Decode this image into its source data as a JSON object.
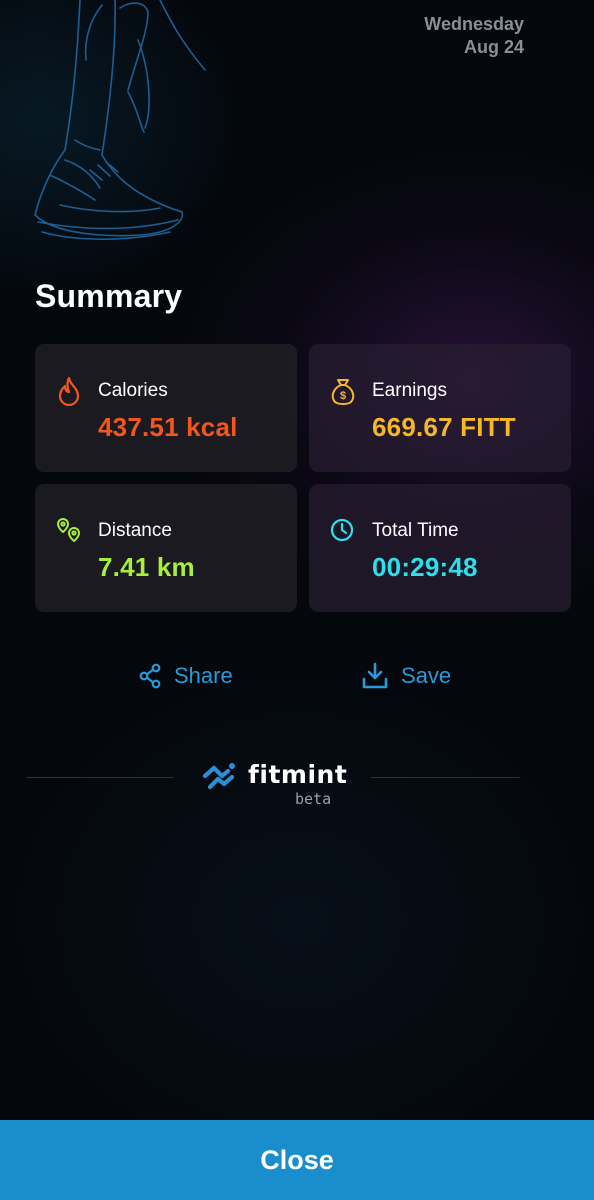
{
  "header": {
    "weekday": "Wednesday",
    "date": "Aug 24"
  },
  "summary": {
    "title": "Summary",
    "stats": [
      {
        "label": "Calories",
        "value": "437.51 kcal",
        "color": "#f4571d",
        "icon": "flame-icon"
      },
      {
        "label": "Earnings",
        "value": "669.67 FITT",
        "color": "#f6b726",
        "icon": "money-bag-icon"
      },
      {
        "label": "Distance",
        "value": "7.41 km",
        "color": "#a7ef3a",
        "icon": "location-pins-icon"
      },
      {
        "label": "Total Time",
        "value": "00:29:48",
        "color": "#2de0ea",
        "icon": "clock-icon"
      }
    ]
  },
  "actions": {
    "share_label": "Share",
    "save_label": "Save",
    "color": "#2a9ad8"
  },
  "brand": {
    "name": "fitmint",
    "tag": "beta"
  },
  "footer": {
    "close_label": "Close",
    "color": "#1a8dcc"
  }
}
